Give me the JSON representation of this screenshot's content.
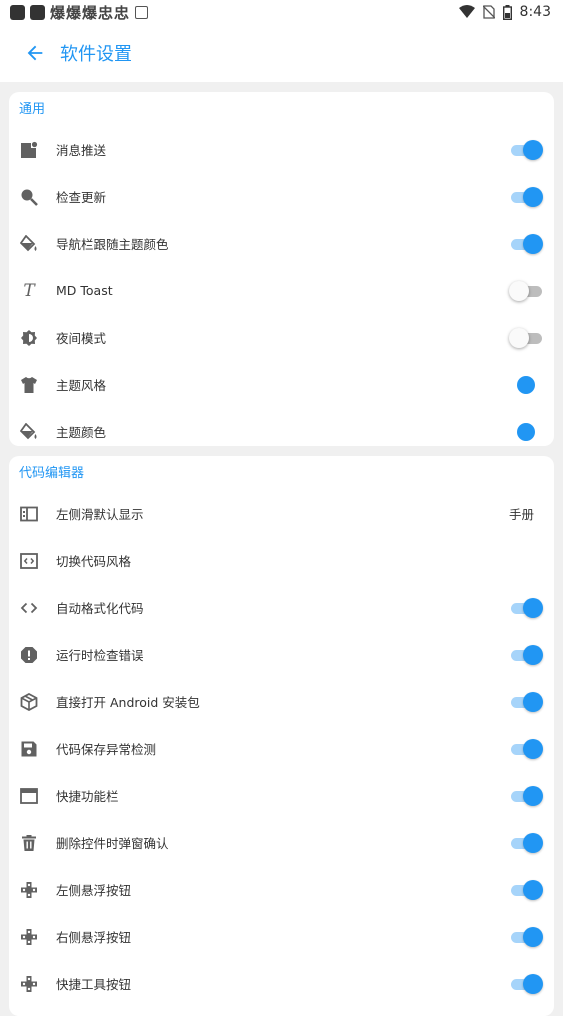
{
  "status_bar": {
    "time": "8:43",
    "notification_glyphs": "爆爆爆忠忠",
    "icons": [
      "app-icon",
      "square-icon",
      "a-icon",
      "wifi-icon",
      "no-sim-icon",
      "battery-icon"
    ]
  },
  "app_bar": {
    "title": "软件设置",
    "back_icon": "arrow-back-icon"
  },
  "accent_color": "#2196f3",
  "sections": {
    "general": {
      "title": "通用",
      "items": [
        {
          "label": "消息推送",
          "icon": "notification-icon",
          "control": "switch",
          "on": true
        },
        {
          "label": "检查更新",
          "icon": "search-icon",
          "control": "switch",
          "on": true
        },
        {
          "label": "导航栏跟随主题颜色",
          "icon": "paint-bucket-icon",
          "control": "switch",
          "on": true
        },
        {
          "label": "MD Toast",
          "icon": "text-italic-icon",
          "control": "switch",
          "on": false
        },
        {
          "label": "夜间模式",
          "icon": "brightness-icon",
          "control": "switch",
          "on": false
        },
        {
          "label": "主题风格",
          "icon": "tshirt-icon",
          "control": "color",
          "color": "#2196f3"
        },
        {
          "label": "主题颜色",
          "icon": "paint-bucket-icon",
          "control": "color",
          "color": "#2196f3"
        }
      ]
    },
    "code_editor": {
      "title": "代码编辑器",
      "items": [
        {
          "label": "左侧滑默认显示",
          "icon": "sidebar-icon",
          "control": "value",
          "value": "手册"
        },
        {
          "label": "切换代码风格",
          "icon": "code-box-icon",
          "control": "none"
        },
        {
          "label": "自动格式化代码",
          "icon": "code-icon",
          "control": "switch",
          "on": true
        },
        {
          "label": "运行时检查错误",
          "icon": "alert-icon",
          "control": "switch",
          "on": true
        },
        {
          "label": "直接打开 Android 安装包",
          "icon": "package-icon",
          "control": "switch",
          "on": true
        },
        {
          "label": "代码保存异常检测",
          "icon": "save-icon",
          "control": "switch",
          "on": true
        },
        {
          "label": "快捷功能栏",
          "icon": "window-icon",
          "control": "switch",
          "on": true
        },
        {
          "label": "删除控件时弹窗确认",
          "icon": "trash-icon",
          "control": "switch",
          "on": true
        },
        {
          "label": "左侧悬浮按钮",
          "icon": "gamepad-icon",
          "control": "switch",
          "on": true
        },
        {
          "label": "右侧悬浮按钮",
          "icon": "gamepad-icon",
          "control": "switch",
          "on": true
        },
        {
          "label": "快捷工具按钮",
          "icon": "gamepad-icon",
          "control": "switch",
          "on": true
        }
      ]
    }
  }
}
